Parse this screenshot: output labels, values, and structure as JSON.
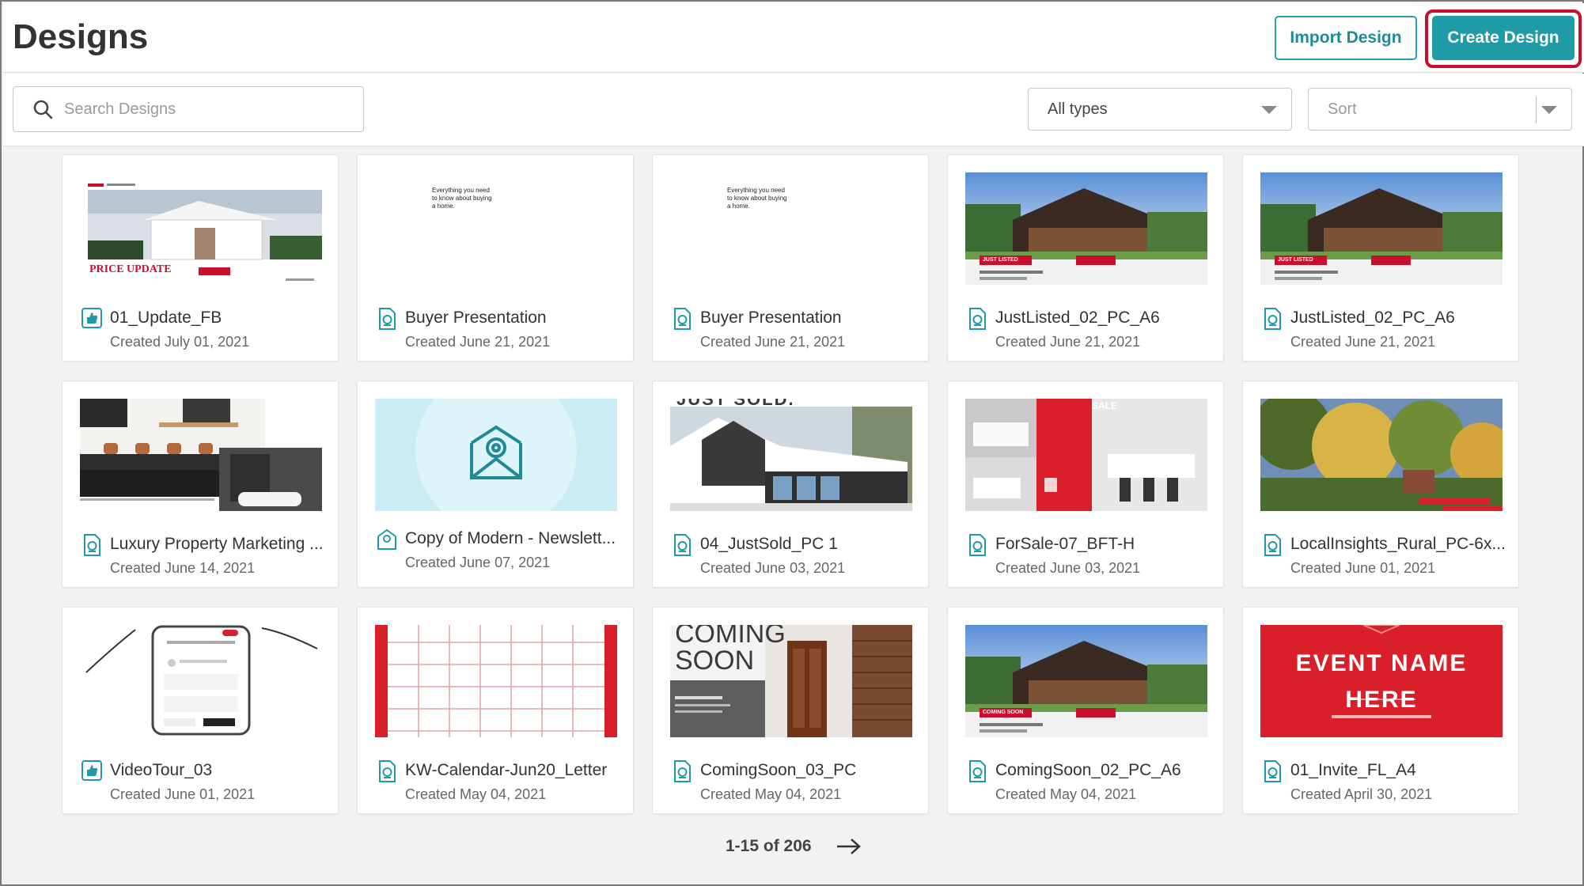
{
  "header": {
    "title": "Designs",
    "import_label": "Import Design",
    "create_label": "Create Design"
  },
  "toolbar": {
    "search_placeholder": "Search Designs",
    "type_filter": "All types",
    "sort_placeholder": "Sort"
  },
  "colors": {
    "accent": "#1f9aa6",
    "highlight": "#c8102e",
    "brand_red": "#d81f2a"
  },
  "designs": [
    {
      "title": "01_Update_FB",
      "date": "Created July 01, 2021",
      "icon": "social-post-icon",
      "thumb_text": "PRICE UPDATE"
    },
    {
      "title": "Buyer Presentation",
      "date": "Created June 21, 2021",
      "icon": "document-icon",
      "thumb_text": "Everything you need to know about buying a home."
    },
    {
      "title": "Buyer Presentation",
      "date": "Created June 21, 2021",
      "icon": "document-icon",
      "thumb_text": "Everything you need to know about buying a home."
    },
    {
      "title": "JustListed_02_PC_A6",
      "date": "Created June 21, 2021",
      "icon": "document-icon",
      "thumb_text": "JUST LISTED"
    },
    {
      "title": "JustListed_02_PC_A6",
      "date": "Created June 21, 2021",
      "icon": "document-icon",
      "thumb_text": "JUST LISTED"
    },
    {
      "title": "Luxury Property Marketing ...",
      "date": "Created June 14, 2021",
      "icon": "document-icon",
      "thumb_text": ""
    },
    {
      "title": "Copy of Modern - Newslett...",
      "date": "Created June 07, 2021",
      "icon": "email-icon",
      "thumb_text": ""
    },
    {
      "title": "04_JustSold_PC 1",
      "date": "Created June 03, 2021",
      "icon": "document-icon",
      "thumb_text": "JUST SOLD."
    },
    {
      "title": "ForSale-07_BFT-H",
      "date": "Created June 03, 2021",
      "icon": "document-icon",
      "thumb_text": "SALE"
    },
    {
      "title": "LocalInsights_Rural_PC-6x...",
      "date": "Created June 01, 2021",
      "icon": "document-icon",
      "thumb_text": ""
    },
    {
      "title": "VideoTour_03",
      "date": "Created June 01, 2021",
      "icon": "social-post-icon",
      "thumb_text": ""
    },
    {
      "title": "KW-Calendar-Jun20_Letter",
      "date": "Created May 04, 2021",
      "icon": "document-icon",
      "thumb_text": ""
    },
    {
      "title": "ComingSoon_03_PC",
      "date": "Created May 04, 2021",
      "icon": "document-icon",
      "thumb_text": "COMING SOON"
    },
    {
      "title": "ComingSoon_02_PC_A6",
      "date": "Created May 04, 2021",
      "icon": "document-icon",
      "thumb_text": "COMING SOON"
    },
    {
      "title": "01_Invite_FL_A4",
      "date": "Created April 30, 2021",
      "icon": "document-icon",
      "thumb_text": "EVENT NAME HERE"
    }
  ],
  "pagination": {
    "label": "1-15 of 206"
  }
}
